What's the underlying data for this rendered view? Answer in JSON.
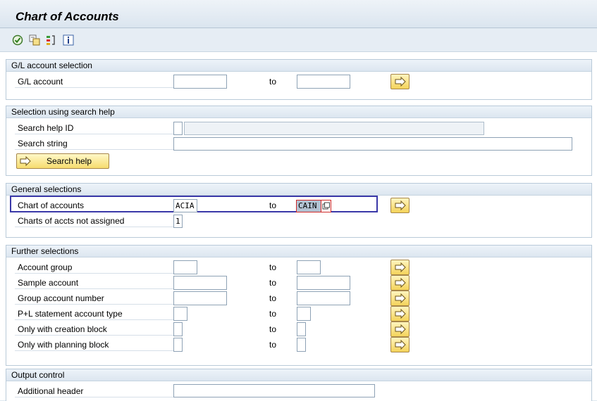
{
  "window": {
    "title": "Chart of Accounts"
  },
  "toolbar": {
    "icons": [
      "execute-icon",
      "get-variant-icon",
      "selection-options-icon",
      "info-icon"
    ]
  },
  "groups": {
    "gl": {
      "title": "G/L account selection",
      "gl_account": {
        "label": "G/L account",
        "from": "",
        "to_label": "to",
        "to": ""
      }
    },
    "search": {
      "title": "Selection using search help",
      "search_help_id": {
        "label": "Search help ID",
        "value": "",
        "description": ""
      },
      "search_string": {
        "label": "Search string",
        "value": ""
      },
      "search_button": "Search help"
    },
    "general": {
      "title": "General selections",
      "chart_of_accounts": {
        "label": "Chart of accounts",
        "from": "ACIA",
        "to_label": "to",
        "to": "CAIN"
      },
      "not_assigned": {
        "label": "Charts of accts not assigned",
        "value": "1"
      }
    },
    "further": {
      "title": "Further selections",
      "rows": [
        {
          "label": "Account group",
          "from": "",
          "to_label": "to",
          "to": ""
        },
        {
          "label": "Sample account",
          "from": "",
          "to_label": "to",
          "to": ""
        },
        {
          "label": "Group account number",
          "from": "",
          "to_label": "to",
          "to": ""
        },
        {
          "label": "P+L statement account type",
          "from": "",
          "to_label": "to",
          "to": ""
        },
        {
          "label": "Only with creation block",
          "from": "",
          "to_label": "to",
          "to": ""
        },
        {
          "label": "Only with planning block",
          "from": "",
          "to_label": "to",
          "to": ""
        }
      ]
    },
    "output": {
      "title": "Output control",
      "additional_header": {
        "label": "Additional header",
        "value": ""
      }
    }
  }
}
